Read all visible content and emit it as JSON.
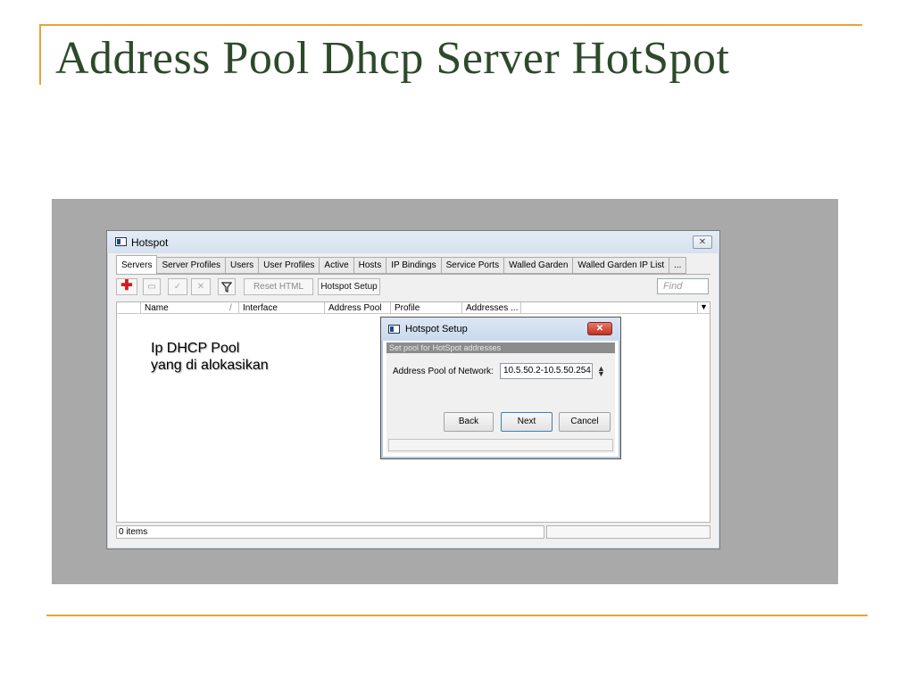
{
  "slide": {
    "title": "Address Pool Dhcp Server HotSpot",
    "accent_color": "#e8a43a"
  },
  "window": {
    "title": "Hotspot",
    "close_glyph": "✕",
    "tabs": [
      "Servers",
      "Server Profiles",
      "Users",
      "User Profiles",
      "Active",
      "Hosts",
      "IP Bindings",
      "Service Ports",
      "Walled Garden",
      "Walled Garden IP List",
      "..."
    ],
    "active_tab": "Servers",
    "toolbar": {
      "add_icon": "plus-icon",
      "remove_icon": "minus-icon",
      "enable_icon": "check-icon",
      "disable_icon": "cross-icon",
      "filter_icon": "filter-icon",
      "reset_html": "Reset HTML",
      "hotspot_setup": "Hotspot Setup",
      "find_placeholder": "Find"
    },
    "columns": [
      "Name",
      "Interface",
      "Address Pool",
      "Profile",
      "Addresses ..."
    ],
    "sort_glyph": "/",
    "annotation": [
      "Ip DHCP Pool",
      "yang di alokasikan"
    ],
    "status": "0 items"
  },
  "dialog": {
    "title": "Hotspot Setup",
    "close_glyph": "✕",
    "banner": "Set pool for HotSpot addresses",
    "field_label": "Address Pool of Network:",
    "field_value": "10.5.50.2-10.5.50.254",
    "buttons": {
      "back": "Back",
      "next": "Next",
      "cancel": "Cancel"
    }
  }
}
